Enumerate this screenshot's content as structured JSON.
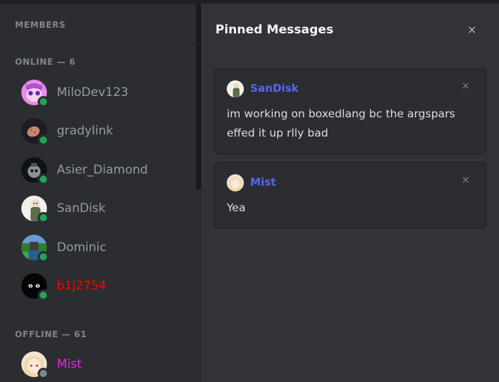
{
  "sidebar": {
    "header": "MEMBERS",
    "online_label": "ONLINE — 6",
    "offline_label": "OFFLINE — 61",
    "members": [
      {
        "name": "MiloDev123",
        "status": "online",
        "color": "#949ba4"
      },
      {
        "name": "gradylink",
        "status": "online",
        "color": "#949ba4"
      },
      {
        "name": "Asier_Diamond",
        "status": "online",
        "color": "#949ba4"
      },
      {
        "name": "SanDisk",
        "status": "online",
        "color": "#949ba4"
      },
      {
        "name": "Dominic",
        "status": "online",
        "color": "#949ba4"
      },
      {
        "name": "b1j2754",
        "status": "online",
        "color": "#ff0000"
      },
      {
        "name": "Mist",
        "status": "offline",
        "color": "#ea26e8"
      }
    ]
  },
  "pinned": {
    "title": "Pinned Messages",
    "close_icon": "×",
    "messages": [
      {
        "author": "SanDisk",
        "text": "im working on boxedlang bc the argspars effed it up rlly bad",
        "close_icon": "×"
      },
      {
        "author": "Mist",
        "text": "Yea",
        "close_icon": "×"
      }
    ]
  },
  "colors": {
    "accent": "#5865f2",
    "online": "#23a559",
    "offline": "#80848e",
    "sidebar_bg": "#2b2d31",
    "panel_bg": "#313338"
  }
}
